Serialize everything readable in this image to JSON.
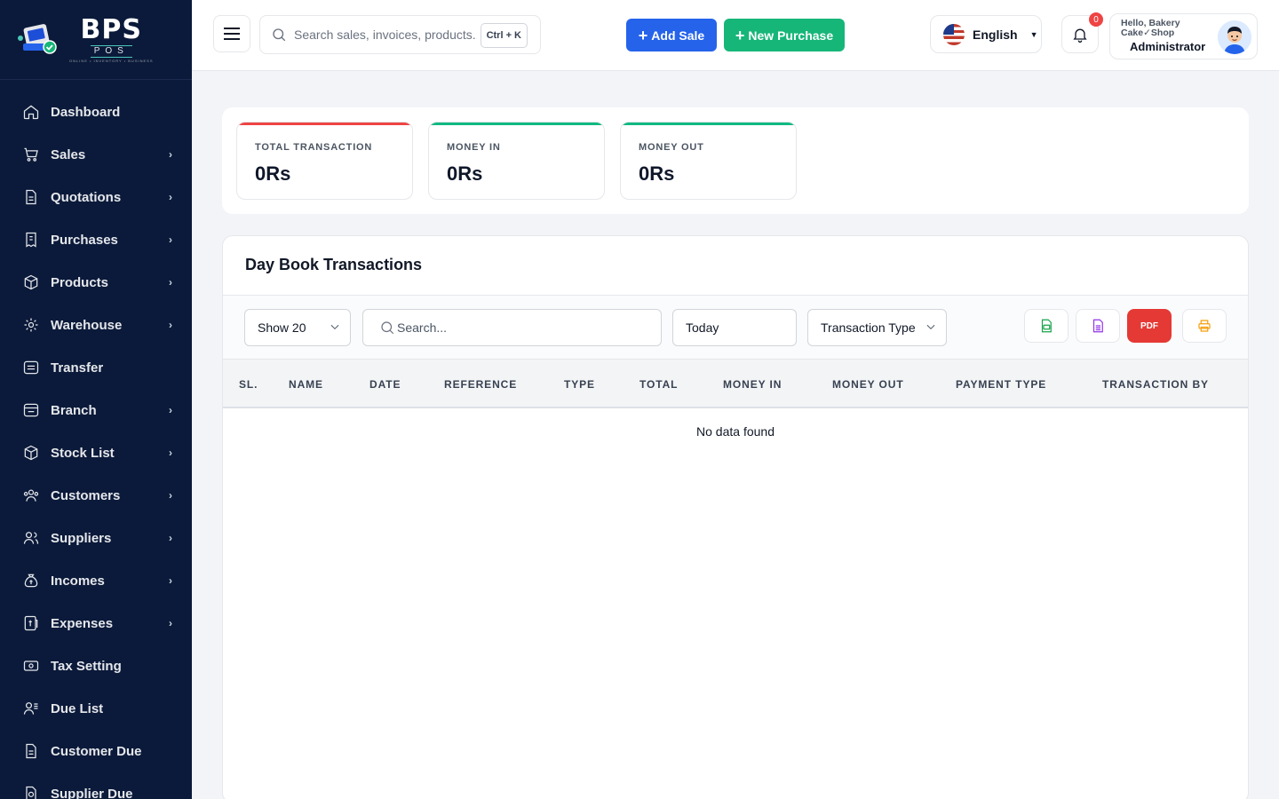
{
  "brand": {
    "name": "BPS",
    "sub": "POS",
    "tagline": "ONLINE • INVENTORY • BUSINESS"
  },
  "sidebar": {
    "items": [
      {
        "label": "Dashboard",
        "icon": "home-icon",
        "has_children": false
      },
      {
        "label": "Sales",
        "icon": "cart-icon",
        "has_children": true
      },
      {
        "label": "Quotations",
        "icon": "document-icon",
        "has_children": true
      },
      {
        "label": "Purchases",
        "icon": "receipt-icon",
        "has_children": true
      },
      {
        "label": "Products",
        "icon": "box-icon",
        "has_children": true
      },
      {
        "label": "Warehouse",
        "icon": "warehouse-icon",
        "has_children": true
      },
      {
        "label": "Transfer",
        "icon": "transfer-icon",
        "has_children": false
      },
      {
        "label": "Branch",
        "icon": "branch-icon",
        "has_children": true
      },
      {
        "label": "Stock List",
        "icon": "stock-icon",
        "has_children": true
      },
      {
        "label": "Customers",
        "icon": "customers-icon",
        "has_children": true
      },
      {
        "label": "Suppliers",
        "icon": "suppliers-icon",
        "has_children": true
      },
      {
        "label": "Incomes",
        "icon": "money-bag-icon",
        "has_children": true
      },
      {
        "label": "Expenses",
        "icon": "expense-icon",
        "has_children": true
      },
      {
        "label": "Tax Setting",
        "icon": "tax-icon",
        "has_children": false
      },
      {
        "label": "Due List",
        "icon": "due-list-icon",
        "has_children": false
      },
      {
        "label": "Customer Due",
        "icon": "customer-due-icon",
        "has_children": false
      },
      {
        "label": "Supplier Due",
        "icon": "supplier-due-icon",
        "has_children": false
      }
    ]
  },
  "header": {
    "search_placeholder": "Search sales, invoices, products...",
    "shortcut": "Ctrl + K",
    "add_sale_label": "Add Sale",
    "new_purchase_label": "New Purchase",
    "language": "English",
    "notification_count": "0",
    "user_greeting": "Hello, Bakery Cake✓Shop",
    "user_role": "Administrator"
  },
  "stats": [
    {
      "title": "TOTAL TRANSACTION",
      "value": "0Rs",
      "accent": "#ef4444"
    },
    {
      "title": "MONEY IN",
      "value": "0Rs",
      "accent": "#10b981"
    },
    {
      "title": "MONEY OUT",
      "value": "0Rs",
      "accent": "#10b981"
    }
  ],
  "panel": {
    "title": "Day Book Transactions",
    "show_select": "Show 20",
    "search_placeholder": "Search...",
    "date_filter": "Today",
    "type_filter": "Transaction Type",
    "export_buttons": [
      "csv-icon",
      "excel-icon",
      "pdf-icon",
      "print-icon"
    ],
    "pdf_label": "PDF"
  },
  "table": {
    "columns": [
      "SL.",
      "NAME",
      "DATE",
      "REFERENCE",
      "TYPE",
      "TOTAL",
      "MONEY IN",
      "MONEY OUT",
      "PAYMENT TYPE",
      "TRANSACTION BY"
    ],
    "empty_text": "No data found"
  },
  "colors": {
    "sidebar_bg": "#0b1a3a",
    "primary": "#2563eb",
    "success": "#16b679",
    "danger": "#ef4444"
  }
}
